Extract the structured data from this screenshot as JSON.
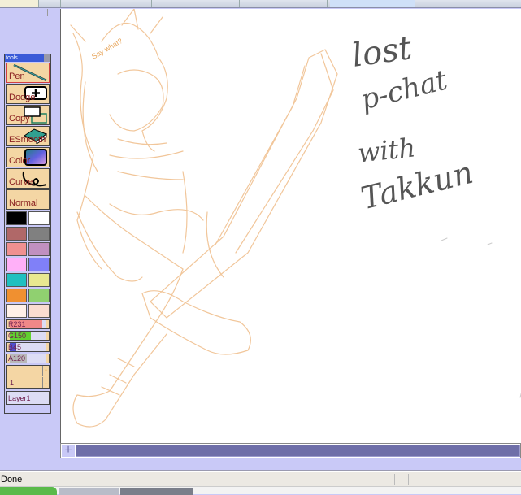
{
  "status": {
    "text": "Done"
  },
  "tools_panel": {
    "title": "tools",
    "tools": [
      {
        "label": "Pen",
        "icon": "pen-icon",
        "active": true
      },
      {
        "label": "Dodge",
        "icon": "dodge-icon"
      },
      {
        "label": "Copy",
        "icon": "copy-icon"
      },
      {
        "label": "ESmooth",
        "icon": "eraser-icon"
      },
      {
        "label": "Color",
        "icon": "color-gradient-icon"
      },
      {
        "label": "Curve",
        "icon": "curve-icon"
      },
      {
        "label": "Normal",
        "icon": ""
      }
    ],
    "swatches": [
      "#000000",
      "#ffffff",
      "#b06868",
      "#808080",
      "#f09090",
      "#c090c0",
      "#ffb0f8",
      "#8080f8",
      "#20c0c0",
      "#e8e890",
      "#f09030",
      "#90d070",
      "#fff0e8",
      "#fadcd0"
    ],
    "sliders": [
      {
        "label": "R231",
        "value": 231,
        "max": 255,
        "color": "#f08888"
      },
      {
        "label": "G150",
        "value": 150,
        "max": 255,
        "color": "#60d030"
      },
      {
        "label": "B45",
        "value": 45,
        "max": 255,
        "color": "#5050d0"
      },
      {
        "label": "A120",
        "value": 120,
        "max": 255,
        "color": "#b8b8b8"
      }
    ],
    "layer_number": "1",
    "layer_name": "Layer1"
  },
  "canvas": {
    "sketch_color": "#f0c090",
    "sketch_caption": "Say what?",
    "handwriting": [
      "lost",
      "p-chat",
      "with",
      "Takkun"
    ]
  }
}
